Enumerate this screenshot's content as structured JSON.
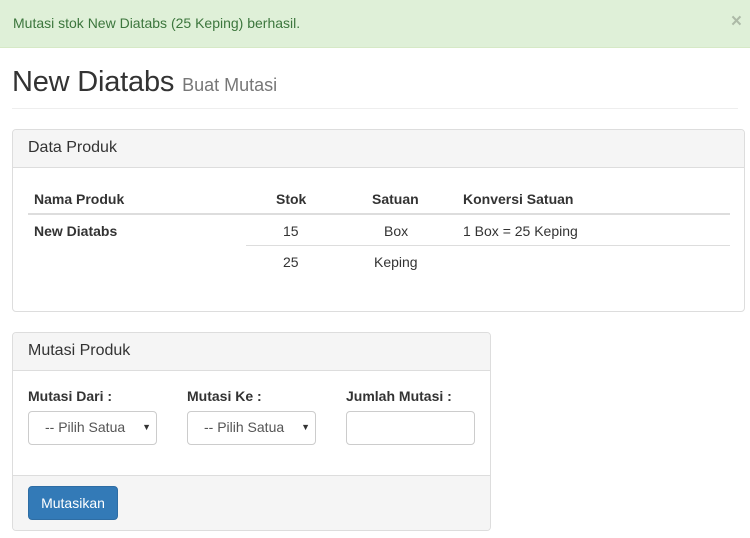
{
  "alert": {
    "message": "Mutasi stok New Diatabs (25 Keping) berhasil.",
    "close": "×"
  },
  "header": {
    "title": "New Diatabs",
    "subtitle": "Buat Mutasi"
  },
  "product_panel": {
    "heading": "Data Produk",
    "columns": [
      "Nama Produk",
      "Stok",
      "Satuan",
      "Konversi Satuan"
    ],
    "product_name": "New Diatabs",
    "rows": [
      {
        "stok": "15",
        "satuan": "Box",
        "konversi": "1 Box = 25 Keping"
      },
      {
        "stok": "25",
        "satuan": "Keping",
        "konversi": ""
      }
    ]
  },
  "mutation_panel": {
    "heading": "Mutasi Produk",
    "from_label": "Mutasi Dari :",
    "from_value": "-- Pilih Satua",
    "to_label": "Mutasi Ke :",
    "to_value": "-- Pilih Satua",
    "amount_label": "Jumlah Mutasi :",
    "amount_value": "",
    "submit_label": "Mutasikan",
    "dropdown_arrow": "▼"
  },
  "colors": {
    "alert_bg": "#dff0d8",
    "alert_text": "#3c763d",
    "primary_button": "#337ab7"
  }
}
